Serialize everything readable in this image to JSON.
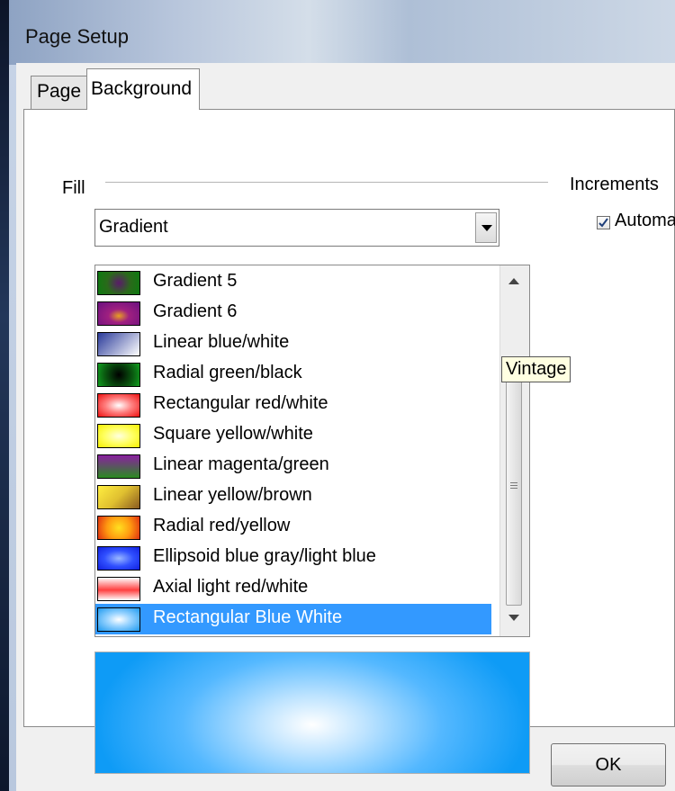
{
  "window": {
    "title": "Page Setup"
  },
  "tabs": [
    {
      "label": "Page",
      "active": false
    },
    {
      "label": "Background",
      "active": true
    }
  ],
  "fill": {
    "group_label": "Fill",
    "type_select": {
      "selected": "Gradient"
    },
    "gradients": [
      {
        "label": "Gradient 5",
        "swatch": "gradient-5"
      },
      {
        "label": "Gradient 6",
        "swatch": "gradient-6"
      },
      {
        "label": "Linear blue/white",
        "swatch": "linear-blue-white"
      },
      {
        "label": "Radial green/black",
        "swatch": "radial-green-black"
      },
      {
        "label": "Rectangular red/white",
        "swatch": "rectangular-red-white"
      },
      {
        "label": "Square yellow/white",
        "swatch": "square-yellow-white"
      },
      {
        "label": "Linear magenta/green",
        "swatch": "linear-magenta-green"
      },
      {
        "label": "Linear yellow/brown",
        "swatch": "linear-yellow-brown"
      },
      {
        "label": "Radial red/yellow",
        "swatch": "radial-red-yellow"
      },
      {
        "label": "Ellipsoid blue gray/light blue",
        "swatch": "ellipsoid-blue"
      },
      {
        "label": "Axial light red/white",
        "swatch": "axial-red-white"
      },
      {
        "label": "Rectangular Blue White",
        "swatch": "rectangular-blue-white",
        "selected": true
      }
    ],
    "tooltip": "Vintage"
  },
  "increments": {
    "group_label": "Increments",
    "automatic_label": "Automa",
    "automatic_checked": true
  },
  "buttons": {
    "ok_label": "OK"
  },
  "colors": {
    "selection": "#3399ff",
    "preview_edge": "#0e9bf6",
    "preview_center": "#ffffff"
  }
}
